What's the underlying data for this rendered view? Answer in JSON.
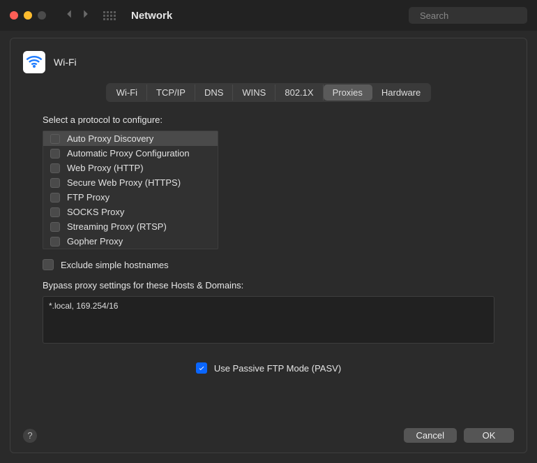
{
  "window": {
    "title": "Network",
    "search_placeholder": "Search"
  },
  "header": {
    "icon": "wifi-icon",
    "label": "Wi-Fi"
  },
  "tabs": [
    {
      "label": "Wi-Fi",
      "active": false
    },
    {
      "label": "TCP/IP",
      "active": false
    },
    {
      "label": "DNS",
      "active": false
    },
    {
      "label": "WINS",
      "active": false
    },
    {
      "label": "802.1X",
      "active": false
    },
    {
      "label": "Proxies",
      "active": true
    },
    {
      "label": "Hardware",
      "active": false
    }
  ],
  "proxies": {
    "select_label": "Select a protocol to configure:",
    "protocols": [
      {
        "label": "Auto Proxy Discovery",
        "checked": false,
        "highlighted": true
      },
      {
        "label": "Automatic Proxy Configuration",
        "checked": false,
        "highlighted": false
      },
      {
        "label": "Web Proxy (HTTP)",
        "checked": false,
        "highlighted": false
      },
      {
        "label": "Secure Web Proxy (HTTPS)",
        "checked": false,
        "highlighted": false
      },
      {
        "label": "FTP Proxy",
        "checked": false,
        "highlighted": false
      },
      {
        "label": "SOCKS Proxy",
        "checked": false,
        "highlighted": false
      },
      {
        "label": "Streaming Proxy (RTSP)",
        "checked": false,
        "highlighted": false
      },
      {
        "label": "Gopher Proxy",
        "checked": false,
        "highlighted": false
      }
    ],
    "exclude_simple": {
      "label": "Exclude simple hostnames",
      "checked": false
    },
    "bypass_label": "Bypass proxy settings for these Hosts & Domains:",
    "bypass_value": "*.local, 169.254/16",
    "passive_ftp": {
      "label": "Use Passive FTP Mode (PASV)",
      "checked": true
    }
  },
  "footer": {
    "cancel": "Cancel",
    "ok": "OK"
  }
}
